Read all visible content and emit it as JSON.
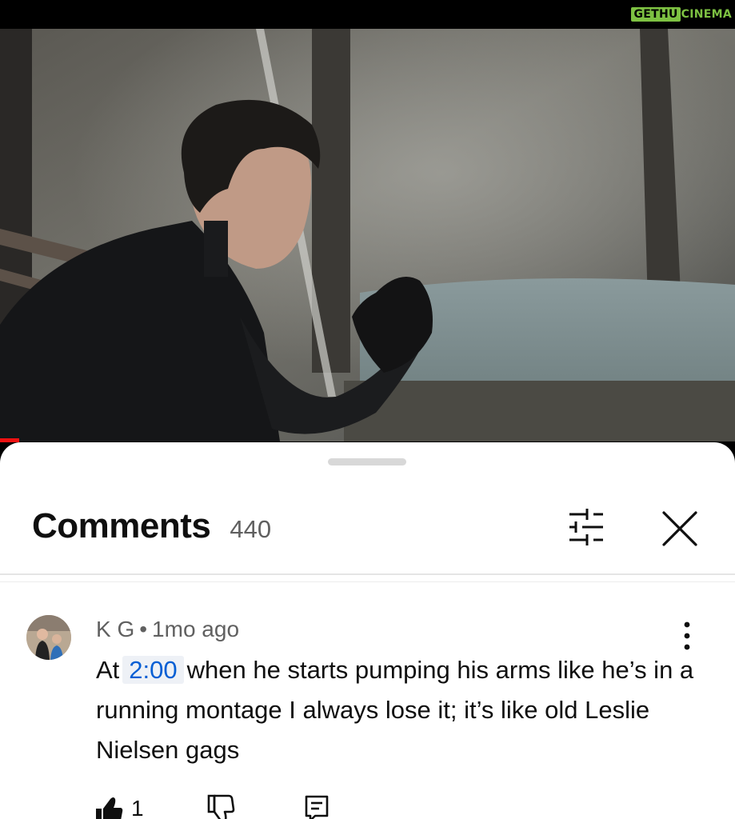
{
  "watermark": {
    "boxed": "GETHU",
    "rest": "CINEMA"
  },
  "video": {
    "description_icon": "video-frame",
    "progress_fraction": 0.026
  },
  "comments_panel": {
    "title": "Comments",
    "count": "440",
    "filter_icon": "sliders-icon",
    "close_icon": "close-icon"
  },
  "comment": {
    "author": "K G",
    "separator": "•",
    "age": "1mo ago",
    "text_before": "At",
    "timestamp": "2:00",
    "text_after": "when he starts pumping his arms like he’s in a running montage I always lose it; it’s like old Leslie Nielsen gags",
    "like_count": "1"
  },
  "colors": {
    "link_blue": "#065fd4",
    "watermark_green": "#7dc142",
    "progress_red": "#ee1111"
  }
}
